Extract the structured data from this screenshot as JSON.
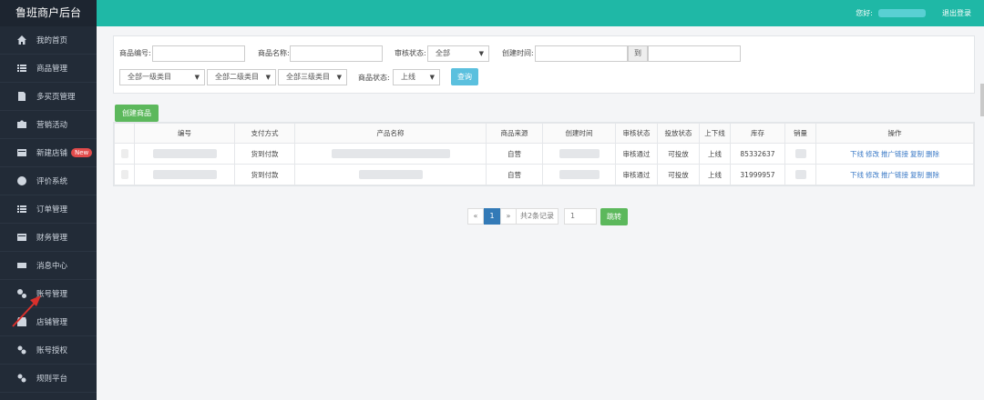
{
  "brand": "鲁班商户后台",
  "topbar": {
    "greeting": "您好:",
    "logout": "退出登录"
  },
  "sidebar": {
    "items": [
      {
        "label": "我的首页",
        "icon": "home-icon"
      },
      {
        "label": "商品管理",
        "icon": "list-icon"
      },
      {
        "label": "多买页管理",
        "icon": "document-icon"
      },
      {
        "label": "营销活动",
        "icon": "camera-icon"
      },
      {
        "label": "新建店铺",
        "icon": "card-icon",
        "badge": "New"
      },
      {
        "label": "评价系统",
        "icon": "user-icon"
      },
      {
        "label": "订单管理",
        "icon": "list-icon"
      },
      {
        "label": "财务管理",
        "icon": "card-icon"
      },
      {
        "label": "消息中心",
        "icon": "mail-icon"
      },
      {
        "label": "账号管理",
        "icon": "gear-icon"
      },
      {
        "label": "店铺管理",
        "icon": "shop-icon"
      },
      {
        "label": "账号授权",
        "icon": "link-icon"
      },
      {
        "label": "规则平台",
        "icon": "link-icon"
      }
    ]
  },
  "filters": {
    "product_id_label": "商品编号:",
    "product_name_label": "商品名称:",
    "audit_status_label": "审核状态:",
    "audit_status_value": "全部",
    "create_time_label": "创建时间:",
    "to_label": "到",
    "cat1": "全部一级类目",
    "cat2": "全部二级类目",
    "cat3": "全部三级类目",
    "shelf_status_label": "商品状态:",
    "shelf_status_value": "上线",
    "search_button": "查询"
  },
  "new_product_button": "创建商品",
  "table": {
    "headers": [
      "",
      "编号",
      "支付方式",
      "产品名称",
      "商品来源",
      "创建时间",
      "审核状态",
      "投放状态",
      "上下线",
      "库存",
      "销量",
      "操作"
    ],
    "rows": [
      {
        "pay": "货到付款",
        "source": "自营",
        "audit": "审核通过",
        "delivery": "可投放",
        "shelf": "上线",
        "stock": "85332637"
      },
      {
        "pay": "货到付款",
        "source": "自营",
        "audit": "审核通过",
        "delivery": "可投放",
        "shelf": "上线",
        "stock": "31999957"
      }
    ],
    "actions": [
      "下线",
      "修改",
      "推广链接",
      "复制",
      "删除"
    ]
  },
  "pager": {
    "prev": "«",
    "current": "1",
    "next": "»",
    "total": "共2条记录",
    "page_input": "1",
    "go_button": "跳转"
  },
  "colors": {
    "sidebar": "#222b37",
    "topbar": "#1fb8a6",
    "primary": "#337ab7",
    "success": "#5cb85c",
    "info": "#5bc0de"
  }
}
